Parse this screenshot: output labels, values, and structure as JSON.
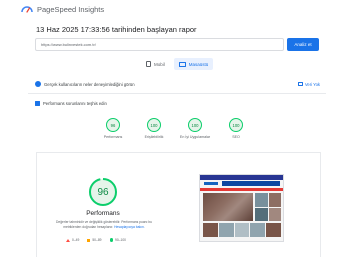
{
  "header": {
    "brand": "PageSpeed Insights"
  },
  "report": {
    "title": "13 Haz 2025 17:33:56 tarihinden başlayan rapor"
  },
  "search": {
    "url_value": "https://www.bulinvestek.com.tr/",
    "analyze_label": "Analiz et"
  },
  "device_tabs": [
    {
      "label": "Mobil",
      "icon": "mobile-icon",
      "active": false
    },
    {
      "label": "Masaüstü",
      "icon": "desktop-icon",
      "active": true
    }
  ],
  "crux": {
    "label": "Gerçek kullanıcıların neler deneyimlediğini görün",
    "link_label": "Veri Yok"
  },
  "diagnose": {
    "label": "Performans sorunlarını teşhis edin"
  },
  "category_scores": [
    {
      "score": "96",
      "label": "Performans"
    },
    {
      "score": "100",
      "label": "Erişilebilirlik"
    },
    {
      "score": "100",
      "label": "En İyi Uygulamalar"
    },
    {
      "score": "100",
      "label": "SEO"
    }
  ],
  "performance": {
    "score": 96,
    "score_label": "96",
    "title": "Performans",
    "desc_text": "Değerler tahminidir ve değişiklik gösterebilir. Performans puanı bu metriklerden doğrudan hesaplanır.",
    "desc_link": "Hesaplayıcıya bakın."
  },
  "legend": [
    {
      "range": "0–49",
      "shape": "triangle",
      "color": "#ff4e42"
    },
    {
      "range": "50–89",
      "shape": "square",
      "color": "#ffa400"
    },
    {
      "range": "90–100",
      "shape": "circle",
      "color": "#0cce6b"
    }
  ],
  "colors": {
    "accent": "#1a73e8",
    "pass": "#0cce6b",
    "pass_text": "#0d8a45"
  }
}
